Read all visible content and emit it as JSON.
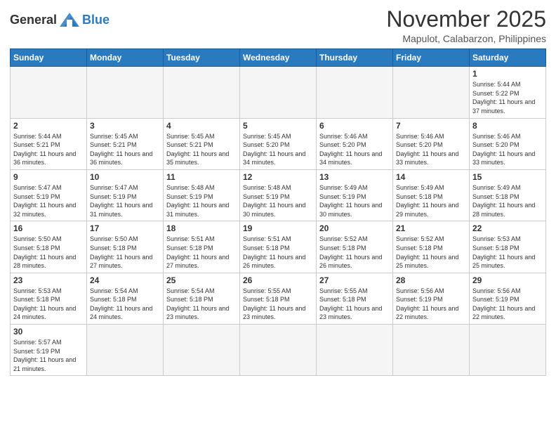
{
  "logo": {
    "text_general": "General",
    "text_blue": "Blue"
  },
  "header": {
    "month": "November 2025",
    "location": "Mapulot, Calabarzon, Philippines"
  },
  "weekdays": [
    "Sunday",
    "Monday",
    "Tuesday",
    "Wednesday",
    "Thursday",
    "Friday",
    "Saturday"
  ],
  "weeks": [
    [
      {
        "date": "",
        "empty": true
      },
      {
        "date": "",
        "empty": true
      },
      {
        "date": "",
        "empty": true
      },
      {
        "date": "",
        "empty": true
      },
      {
        "date": "",
        "empty": true
      },
      {
        "date": "",
        "empty": true
      },
      {
        "date": "1",
        "sunrise": "Sunrise: 5:44 AM",
        "sunset": "Sunset: 5:22 PM",
        "daylight": "Daylight: 11 hours and 37 minutes."
      }
    ],
    [
      {
        "date": "2",
        "sunrise": "Sunrise: 5:44 AM",
        "sunset": "Sunset: 5:21 PM",
        "daylight": "Daylight: 11 hours and 36 minutes."
      },
      {
        "date": "3",
        "sunrise": "Sunrise: 5:45 AM",
        "sunset": "Sunset: 5:21 PM",
        "daylight": "Daylight: 11 hours and 36 minutes."
      },
      {
        "date": "4",
        "sunrise": "Sunrise: 5:45 AM",
        "sunset": "Sunset: 5:21 PM",
        "daylight": "Daylight: 11 hours and 35 minutes."
      },
      {
        "date": "5",
        "sunrise": "Sunrise: 5:45 AM",
        "sunset": "Sunset: 5:20 PM",
        "daylight": "Daylight: 11 hours and 34 minutes."
      },
      {
        "date": "6",
        "sunrise": "Sunrise: 5:46 AM",
        "sunset": "Sunset: 5:20 PM",
        "daylight": "Daylight: 11 hours and 34 minutes."
      },
      {
        "date": "7",
        "sunrise": "Sunrise: 5:46 AM",
        "sunset": "Sunset: 5:20 PM",
        "daylight": "Daylight: 11 hours and 33 minutes."
      },
      {
        "date": "8",
        "sunrise": "Sunrise: 5:46 AM",
        "sunset": "Sunset: 5:20 PM",
        "daylight": "Daylight: 11 hours and 33 minutes."
      }
    ],
    [
      {
        "date": "9",
        "sunrise": "Sunrise: 5:47 AM",
        "sunset": "Sunset: 5:19 PM",
        "daylight": "Daylight: 11 hours and 32 minutes."
      },
      {
        "date": "10",
        "sunrise": "Sunrise: 5:47 AM",
        "sunset": "Sunset: 5:19 PM",
        "daylight": "Daylight: 11 hours and 31 minutes."
      },
      {
        "date": "11",
        "sunrise": "Sunrise: 5:48 AM",
        "sunset": "Sunset: 5:19 PM",
        "daylight": "Daylight: 11 hours and 31 minutes."
      },
      {
        "date": "12",
        "sunrise": "Sunrise: 5:48 AM",
        "sunset": "Sunset: 5:19 PM",
        "daylight": "Daylight: 11 hours and 30 minutes."
      },
      {
        "date": "13",
        "sunrise": "Sunrise: 5:49 AM",
        "sunset": "Sunset: 5:19 PM",
        "daylight": "Daylight: 11 hours and 30 minutes."
      },
      {
        "date": "14",
        "sunrise": "Sunrise: 5:49 AM",
        "sunset": "Sunset: 5:18 PM",
        "daylight": "Daylight: 11 hours and 29 minutes."
      },
      {
        "date": "15",
        "sunrise": "Sunrise: 5:49 AM",
        "sunset": "Sunset: 5:18 PM",
        "daylight": "Daylight: 11 hours and 28 minutes."
      }
    ],
    [
      {
        "date": "16",
        "sunrise": "Sunrise: 5:50 AM",
        "sunset": "Sunset: 5:18 PM",
        "daylight": "Daylight: 11 hours and 28 minutes."
      },
      {
        "date": "17",
        "sunrise": "Sunrise: 5:50 AM",
        "sunset": "Sunset: 5:18 PM",
        "daylight": "Daylight: 11 hours and 27 minutes."
      },
      {
        "date": "18",
        "sunrise": "Sunrise: 5:51 AM",
        "sunset": "Sunset: 5:18 PM",
        "daylight": "Daylight: 11 hours and 27 minutes."
      },
      {
        "date": "19",
        "sunrise": "Sunrise: 5:51 AM",
        "sunset": "Sunset: 5:18 PM",
        "daylight": "Daylight: 11 hours and 26 minutes."
      },
      {
        "date": "20",
        "sunrise": "Sunrise: 5:52 AM",
        "sunset": "Sunset: 5:18 PM",
        "daylight": "Daylight: 11 hours and 26 minutes."
      },
      {
        "date": "21",
        "sunrise": "Sunrise: 5:52 AM",
        "sunset": "Sunset: 5:18 PM",
        "daylight": "Daylight: 11 hours and 25 minutes."
      },
      {
        "date": "22",
        "sunrise": "Sunrise: 5:53 AM",
        "sunset": "Sunset: 5:18 PM",
        "daylight": "Daylight: 11 hours and 25 minutes."
      }
    ],
    [
      {
        "date": "23",
        "sunrise": "Sunrise: 5:53 AM",
        "sunset": "Sunset: 5:18 PM",
        "daylight": "Daylight: 11 hours and 24 minutes."
      },
      {
        "date": "24",
        "sunrise": "Sunrise: 5:54 AM",
        "sunset": "Sunset: 5:18 PM",
        "daylight": "Daylight: 11 hours and 24 minutes."
      },
      {
        "date": "25",
        "sunrise": "Sunrise: 5:54 AM",
        "sunset": "Sunset: 5:18 PM",
        "daylight": "Daylight: 11 hours and 23 minutes."
      },
      {
        "date": "26",
        "sunrise": "Sunrise: 5:55 AM",
        "sunset": "Sunset: 5:18 PM",
        "daylight": "Daylight: 11 hours and 23 minutes."
      },
      {
        "date": "27",
        "sunrise": "Sunrise: 5:55 AM",
        "sunset": "Sunset: 5:18 PM",
        "daylight": "Daylight: 11 hours and 23 minutes."
      },
      {
        "date": "28",
        "sunrise": "Sunrise: 5:56 AM",
        "sunset": "Sunset: 5:19 PM",
        "daylight": "Daylight: 11 hours and 22 minutes."
      },
      {
        "date": "29",
        "sunrise": "Sunrise: 5:56 AM",
        "sunset": "Sunset: 5:19 PM",
        "daylight": "Daylight: 11 hours and 22 minutes."
      }
    ],
    [
      {
        "date": "30",
        "sunrise": "Sunrise: 5:57 AM",
        "sunset": "Sunset: 5:19 PM",
        "daylight": "Daylight: 11 hours and 21 minutes."
      },
      {
        "date": "",
        "empty": true
      },
      {
        "date": "",
        "empty": true
      },
      {
        "date": "",
        "empty": true
      },
      {
        "date": "",
        "empty": true
      },
      {
        "date": "",
        "empty": true
      },
      {
        "date": "",
        "empty": true
      }
    ]
  ]
}
